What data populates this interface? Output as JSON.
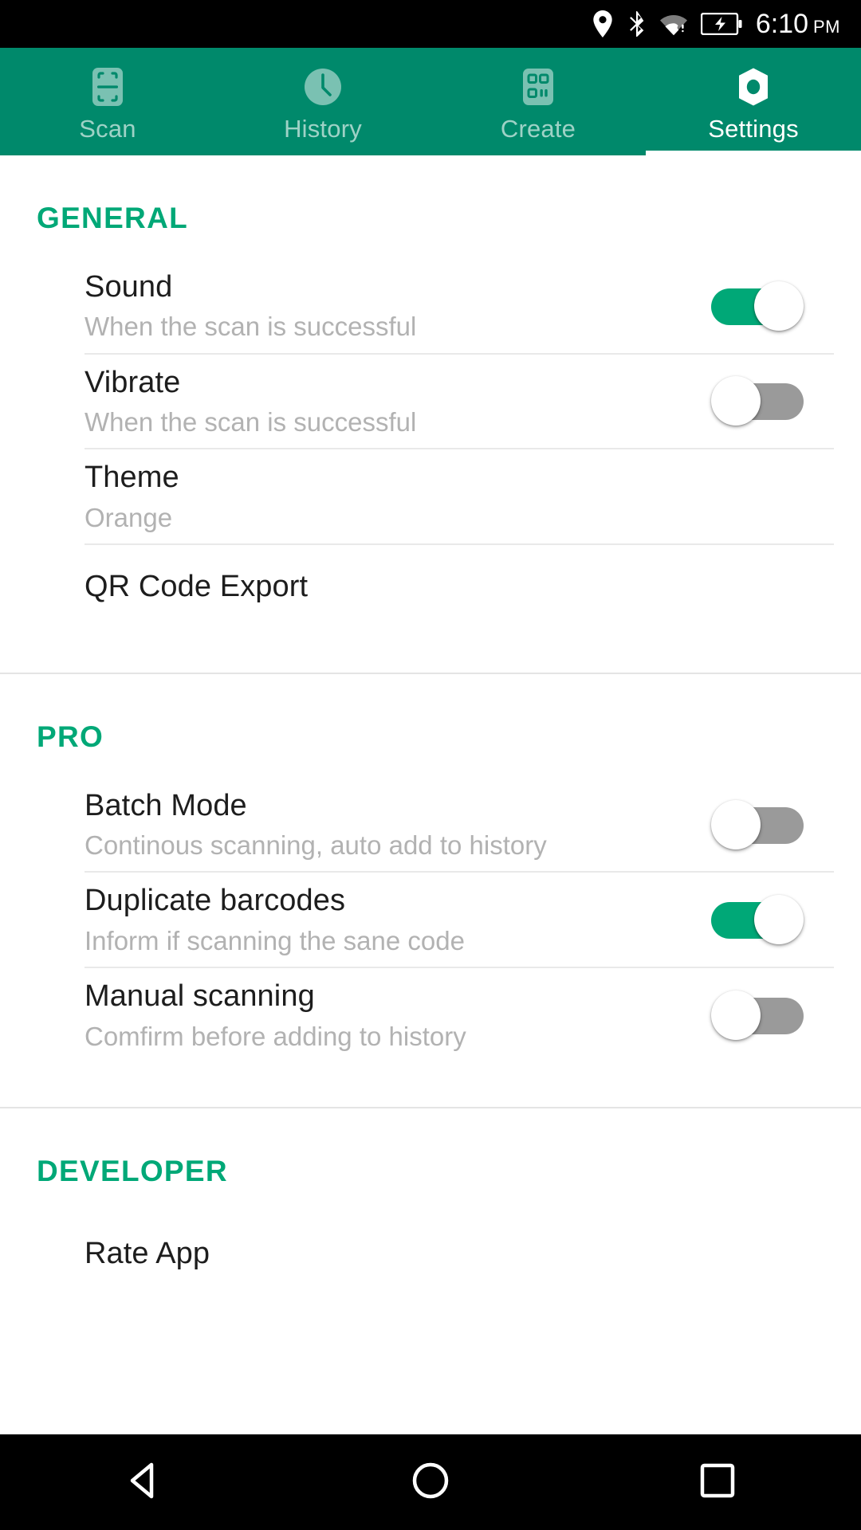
{
  "status_bar": {
    "time": "6:10",
    "ampm": "PM",
    "icons": [
      "location-pin-icon",
      "bluetooth-icon",
      "wifi-icon",
      "battery-charging-icon"
    ]
  },
  "tabs": [
    {
      "label": "Scan",
      "icon": "scan-frame-icon",
      "active": false
    },
    {
      "label": "History",
      "icon": "clock-icon",
      "active": false
    },
    {
      "label": "Create",
      "icon": "qr-grid-icon",
      "active": false
    },
    {
      "label": "Settings",
      "icon": "hex-nut-icon",
      "active": true
    }
  ],
  "sections": [
    {
      "title": "GENERAL",
      "rows": [
        {
          "title": "Sound",
          "subtitle": "When the scan is successful",
          "control": "toggle",
          "value": "on"
        },
        {
          "title": "Vibrate",
          "subtitle": "When the scan is successful",
          "control": "toggle",
          "value": "off"
        },
        {
          "title": "Theme",
          "subtitle": "Orange",
          "control": "none",
          "value": ""
        },
        {
          "title": "QR Code Export",
          "subtitle": "",
          "control": "none",
          "value": ""
        }
      ]
    },
    {
      "title": "PRO",
      "rows": [
        {
          "title": "Batch Mode",
          "subtitle": "Continous scanning, auto add to history",
          "control": "toggle",
          "value": "off"
        },
        {
          "title": "Duplicate barcodes",
          "subtitle": "Inform if scanning the sane code",
          "control": "toggle",
          "value": "on"
        },
        {
          "title": "Manual scanning",
          "subtitle": "Comfirm before adding to history",
          "control": "toggle",
          "value": "off"
        }
      ]
    },
    {
      "title": "DEVELOPER",
      "rows": [
        {
          "title": "Rate App",
          "subtitle": "",
          "control": "none",
          "value": ""
        }
      ]
    }
  ],
  "nav_bar": {
    "buttons": [
      {
        "name": "back-button",
        "icon": "triangle-back-icon"
      },
      {
        "name": "home-button",
        "icon": "circle-home-icon"
      },
      {
        "name": "recents-button",
        "icon": "square-recents-icon"
      }
    ]
  },
  "colors": {
    "primary": "#00896b",
    "accent": "#00a877",
    "toggle_on": "#00a877",
    "toggle_off": "#9a9a9a",
    "status_bar": "#000000"
  }
}
